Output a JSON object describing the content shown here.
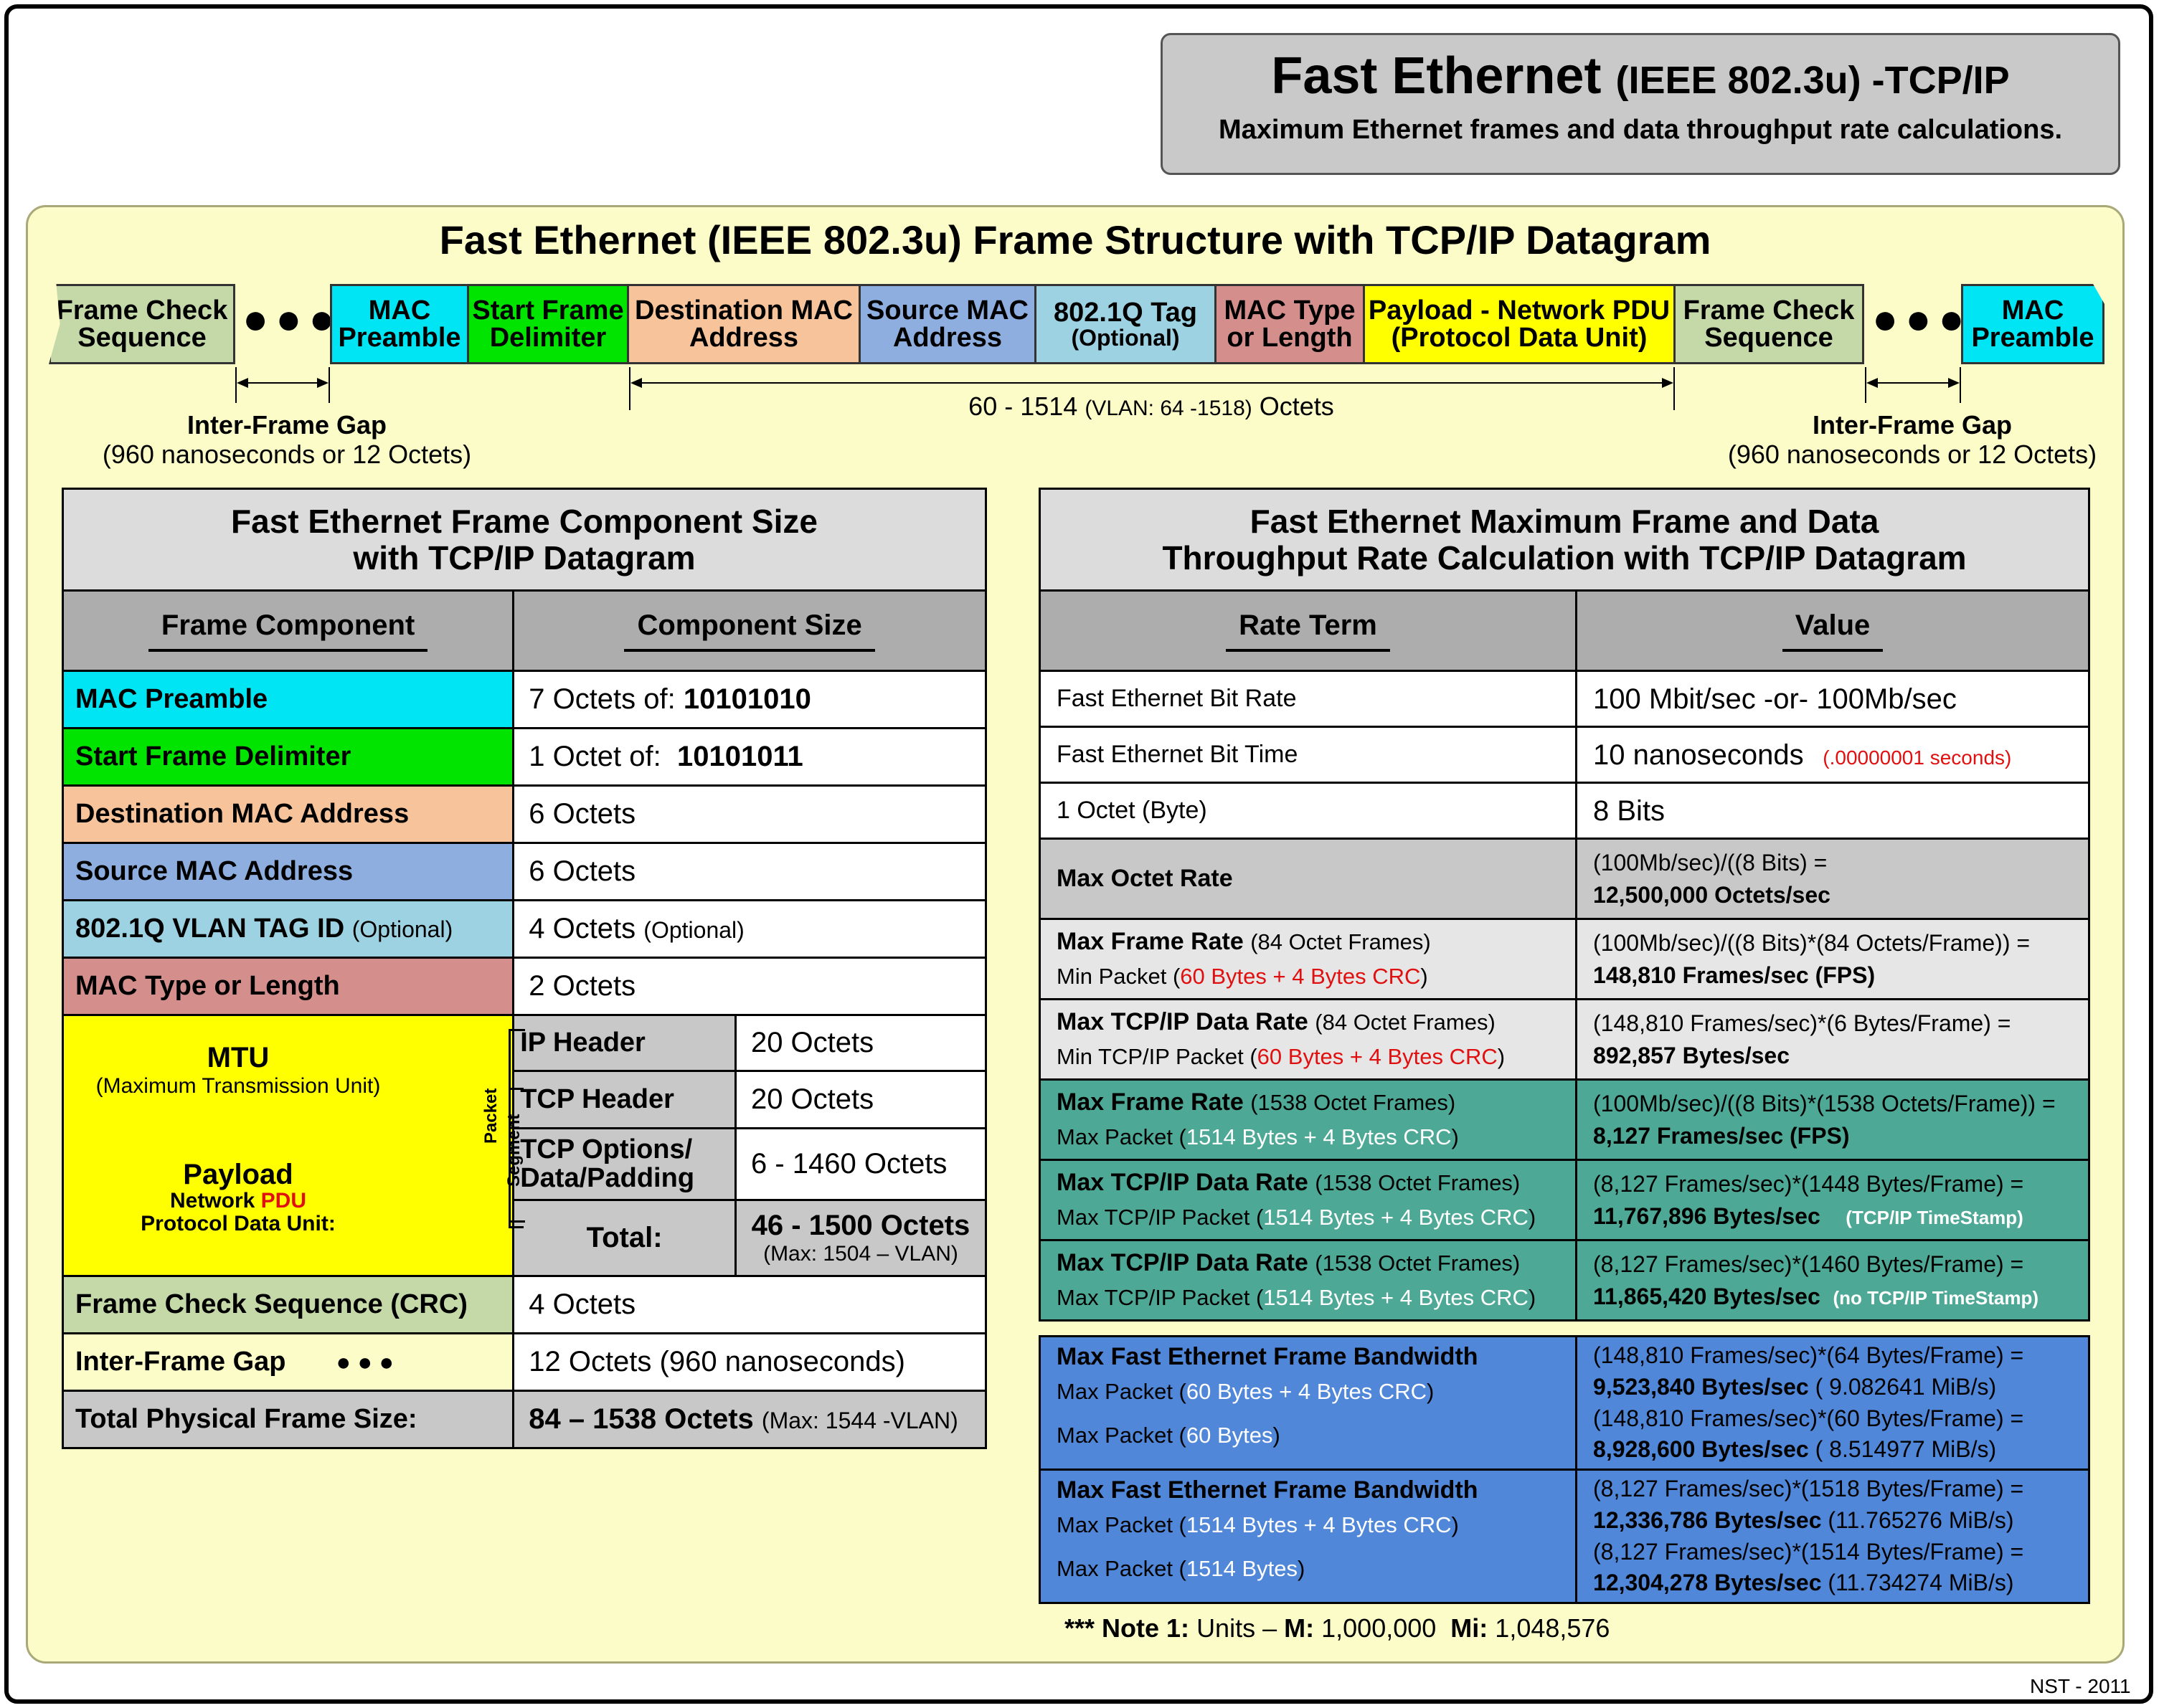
{
  "header": {
    "title_main": "Fast Ethernet",
    "title_suffix": "(IEEE 802.3u) -TCP/IP",
    "subtitle": "Maximum Ethernet frames and data throughput rate calculations."
  },
  "frame_structure": {
    "title": "Fast Ethernet (IEEE 802.3u) Frame Structure with TCP/IP Datagram",
    "fields": {
      "fcs_left": "Frame Check Sequence",
      "preamble": "MAC Preamble",
      "sfd": "Start Frame Delimiter",
      "dest": "Destination MAC Address",
      "src": "Source MAC Address",
      "vlan_title": "802.1Q Tag",
      "vlan_opt": "(Optional)",
      "type": "MAC Type or Length",
      "payload": "Payload - Network PDU (Protocol Data Unit)",
      "fcs_right": "Frame Check Sequence",
      "preamble_right": "MAC Preamble"
    },
    "dots": "●●●",
    "gap_title": "Inter-Frame Gap",
    "gap_detail": "(960 nanoseconds or 12 Octets)",
    "octets_main": "60 - 1514",
    "octets_vlan": "(VLAN: 64 -1518)",
    "octets_unit": "Octets",
    "colors": {
      "fcs": "#c4d8a8",
      "preamble": "#00e5f4",
      "sfd": "#00e400",
      "dest": "#f6c39a",
      "src": "#8eaee0",
      "vlan": "#9dd2e2",
      "type": "#d48f8c",
      "payload": "#ffff00"
    }
  },
  "left_table": {
    "title_line1": "Fast Ethernet Frame Component Size",
    "title_line2": "with TCP/IP Datagram",
    "col1": "Frame Component",
    "col2": "Component Size",
    "rows": {
      "preamble": {
        "label": "MAC Preamble",
        "v1": "7 Octets of: ",
        "v2": "10101010"
      },
      "sfd": {
        "label": "Start Frame Delimiter",
        "v1": "1 Octet of:  ",
        "v2": "10101011"
      },
      "dest": {
        "label": "Destination MAC Address",
        "v1": "6 Octets"
      },
      "src": {
        "label": "Source MAC Address",
        "v1": "6 Octets"
      },
      "vlan": {
        "label": "802.1Q VLAN TAG ID",
        "label_opt": "(Optional)",
        "v1": "4 Octets",
        "v2": "(Optional)"
      },
      "type": {
        "label": "MAC Type or Length",
        "v1": "2 Octets"
      },
      "mtu": {
        "title": "MTU",
        "subtitle": "(Maximum Transmission Unit)",
        "payload": "Payload",
        "network": "Network",
        "pdu": "PDU",
        "pdu_full": "Protocol Data Unit:",
        "packet_label": "Packet",
        "segment_label": "Segment",
        "ip_label": "IP Header",
        "ip_value": "20 Octets",
        "tcp_label": "TCP Header",
        "tcp_value": "20 Octets",
        "opt_label": "TCP Options/ Data/Padding",
        "opt_value": "6 - 1460 Octets",
        "total_label": "Total:",
        "total_value": "46 - 1500 Octets",
        "total_sub": "(Max: 1504 – VLAN)"
      },
      "fcs": {
        "label": "Frame Check Sequence (CRC)",
        "v1": "4 Octets"
      },
      "ifg": {
        "label": "Inter-Frame Gap",
        "dots": "● ● ●",
        "v1": "12 Octets (960 nanoseconds)"
      },
      "total": {
        "label": "Total Physical Frame Size:",
        "v1": "84 – 1538 Octets",
        "v2": "(Max: 1544 -VLAN)"
      }
    }
  },
  "right_table": {
    "title_line1": "Fast Ethernet Maximum Frame and Data",
    "title_line2": "Throughput Rate Calculation with TCP/IP Datagram",
    "col1": "Rate Term",
    "col2": "Value",
    "rows": {
      "bitrate": {
        "term": "Fast Ethernet Bit Rate",
        "value": "100 Mbit/sec -or- 100Mb/sec"
      },
      "bittime": {
        "term": "Fast Ethernet Bit Time",
        "value": "10 nanoseconds",
        "value_red": "(.00000001 seconds)"
      },
      "octet": {
        "term": "1 Octet (Byte)",
        "value": "8 Bits"
      },
      "octetrate": {
        "term": "Max Octet Rate",
        "formula": "(100Mb/sec)/((8 Bits) =",
        "result": "12,500,000 Octets/sec"
      },
      "frame84": {
        "term": "Max Frame Rate",
        "term_sub": "(84 Octet Frames)",
        "line2_a": "Min Packet (",
        "line2_red": "60 Bytes + 4 Bytes CRC",
        "line2_b": ")",
        "formula": "(100Mb/sec)/((8 Bits)*(84 Octets/Frame)) =",
        "result": "148,810 Frames/sec (FPS)"
      },
      "tcp84": {
        "term": "Max TCP/IP Data Rate",
        "term_sub": "(84 Octet Frames)",
        "line2_a": "Min TCP/IP Packet (",
        "line2_red": "60 Bytes + 4 Bytes CRC",
        "line2_b": ")",
        "formula": "(148,810 Frames/sec)*(6 Bytes/Frame) =",
        "result": "892,857 Bytes/sec"
      },
      "frame1538": {
        "term": "Max Frame Rate",
        "term_sub": "(1538 Octet Frames)",
        "line2_a": "Max Packet (",
        "line2_w": "1514 Bytes + 4 Bytes CRC",
        "line2_b": ")",
        "formula": "(100Mb/sec)/((8 Bits)*(1538 Octets/Frame)) =",
        "result": "8,127 Frames/sec (FPS)"
      },
      "tcp1538a": {
        "term": "Max TCP/IP Data Rate",
        "term_sub": "(1538 Octet Frames)",
        "line2_a": "Max TCP/IP Packet (",
        "line2_w": "1514 Bytes + 4 Bytes CRC",
        "line2_b": ")",
        "formula": "(8,127 Frames/sec)*(1448 Bytes/Frame) =",
        "result": "11,767,896 Bytes/sec",
        "note": "(TCP/IP TimeStamp)"
      },
      "tcp1538b": {
        "term": "Max TCP/IP Data Rate",
        "term_sub": "(1538 Octet Frames)",
        "line2_a": "Max TCP/IP Packet (",
        "line2_w": "1514 Bytes + 4 Bytes CRC",
        "line2_b": ")",
        "formula": "(8,127 Frames/sec)*(1460 Bytes/Frame) =",
        "result": "11,865,420 Bytes/sec",
        "note": "(no TCP/IP TimeStamp)"
      },
      "bw1": {
        "term": "Max Fast Ethernet Frame Bandwidth",
        "l2a": "Max Packet (",
        "l2w": "60 Bytes + 4 Bytes CRC",
        "l2b": ")",
        "l3a": "Max Packet (",
        "l3w": "60 Bytes",
        "l3b": ")",
        "f1": "(148,810 Frames/sec)*(64 Bytes/Frame) =",
        "r1": "9,523,840 Bytes/sec",
        "r1s": "( 9.082641 MiB/s)",
        "f2": "(148,810 Frames/sec)*(60 Bytes/Frame) =",
        "r2": "8,928,600 Bytes/sec",
        "r2s": "( 8.514977 MiB/s)"
      },
      "bw2": {
        "term": "Max Fast Ethernet Frame Bandwidth",
        "l2a": "Max Packet (",
        "l2w": "1514 Bytes + 4 Bytes CRC",
        "l2b": ")",
        "l3a": "Max Packet (",
        "l3w": "1514 Bytes",
        "l3b": ")",
        "f1": "(8,127 Frames/sec)*(1518 Bytes/Frame) =",
        "r1": "12,336,786 Bytes/sec",
        "r1s": "(11.765276 MiB/s)",
        "f2": "(8,127 Frames/sec)*(1514 Bytes/Frame) =",
        "r2": "12,304,278 Bytes/sec",
        "r2s": "(11.734274 MiB/s)"
      }
    },
    "colors": {
      "white": "#ffffff",
      "grey": "#c8c8c8",
      "light": "#e6e6e6",
      "teal": "#4ea896",
      "blue": "#5087d8"
    }
  },
  "note": {
    "prefix": "*** Note 1:",
    "units": "Units –",
    "m": "M:",
    "m_val": "1,000,000",
    "mi": "Mi:",
    "mi_val": "1,048,576"
  },
  "credit": "NST - 2011"
}
